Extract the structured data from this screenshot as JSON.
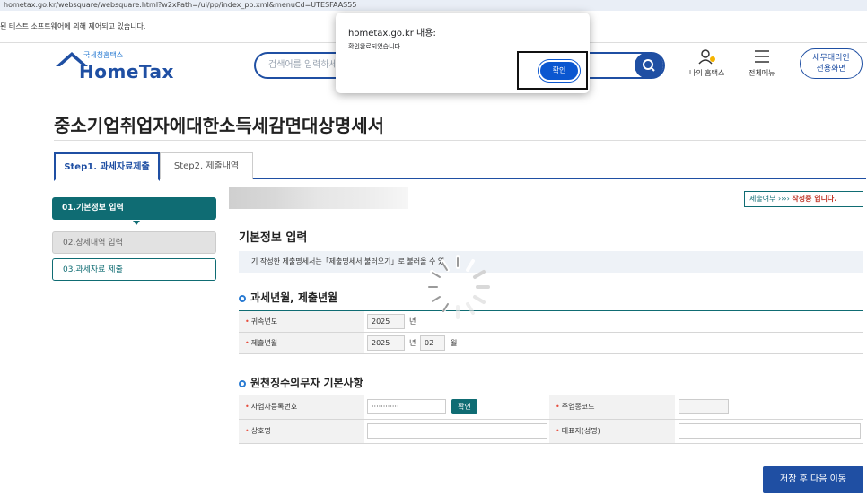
{
  "browser": {
    "url": "hometax.go.kr/websquare/websquare.html?w2xPath=/ui/pp/index_pp.xml&menuCd=UTESFAAS55",
    "info_message": "된 테스트 소프트웨어에 의해 제어되고 있습니다."
  },
  "header": {
    "logo_sub": "국세청홈택스",
    "logo_main": "HomeTax",
    "search_placeholder": "검색어를 입력하세요",
    "my_hometax": "나의 홈택스",
    "all_menu": "전체메뉴",
    "tax_agent_line1": "세무대리인",
    "tax_agent_line2": "전용화면"
  },
  "page": {
    "title": "중소기업취업자에대한소득세감면대상명세서",
    "tabs": [
      "Step1. 과세자료제출",
      "Step2. 제출내역"
    ]
  },
  "steps": [
    "01.기본정보 입력",
    "02.상세내역 입력",
    "03.과세자료 제출"
  ],
  "status": {
    "prefix": "제출여부",
    "arrows": "››››",
    "value": "작성중 입니다."
  },
  "basic_info": {
    "title": "기본정보 입력",
    "notice": "기 작성한 제출명세서는「제출명세서 불러오기」로 불러올 수 있"
  },
  "period_section": {
    "title": "과세년월, 제출년월",
    "rows": [
      {
        "label": "귀속년도",
        "year": "2025",
        "year_unit": "년"
      },
      {
        "label": "제출년월",
        "year": "2025",
        "year_unit": "년",
        "month": "02",
        "month_unit": "월"
      }
    ]
  },
  "withholder_section": {
    "title": "원천징수의무자 기본사항",
    "biz_no_label": "사업자등록번호",
    "biz_no_value": "············",
    "confirm_label": "확인",
    "industry_code_label": "주업종코드",
    "company_label": "상호명",
    "ceo_label": "대표자(성명)"
  },
  "save_next_label": "저장 후 다음 이동",
  "dialog": {
    "title": "hometax.go.kr 내용:",
    "message": "확인완료되었습니다.",
    "ok_label": "확인"
  }
}
